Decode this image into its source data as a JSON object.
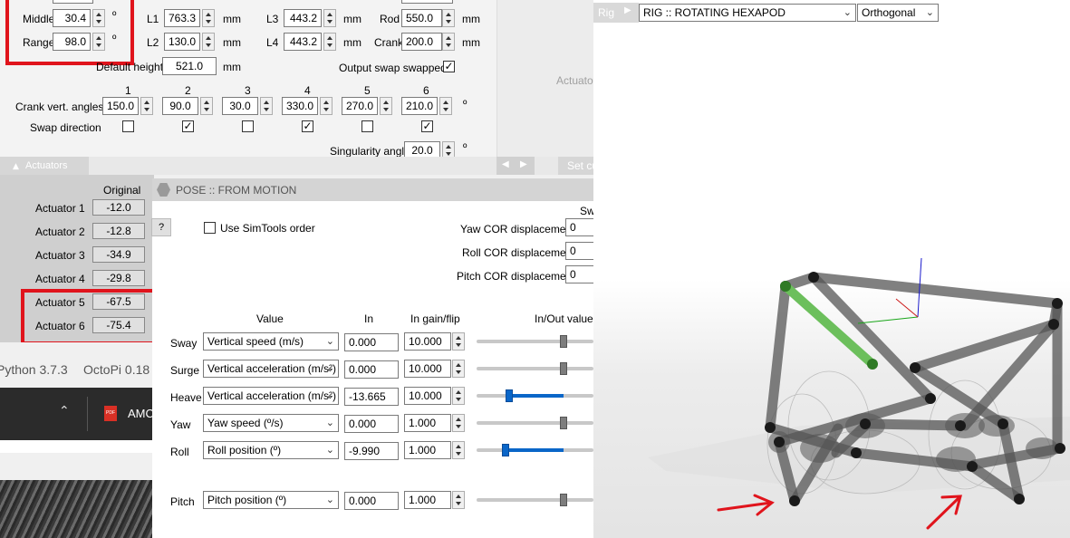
{
  "rig_panel": {
    "middle_label": "Middle",
    "middle_value": "30.4",
    "middle_unit": "º",
    "range_label": "Range",
    "range_value": "98.0",
    "range_unit": "º",
    "l1_label": "L1",
    "l1_value": "763.3",
    "l2_label": "L2",
    "l2_value": "130.0",
    "l3_label": "L3",
    "l3_value": "443.2",
    "l4_label": "L4",
    "l4_value": "443.2",
    "rod_label": "Rod",
    "rod_value": "550.0",
    "crank_label": "Crank",
    "crank_value": "200.0",
    "mm": "mm",
    "default_height_label": "Default height",
    "default_height_value": "521.0",
    "output_swap_label": "Output swap swapped",
    "output_swap_checked": "✓",
    "crank_angles_label": "Crank vert. angles",
    "columns": [
      "1",
      "2",
      "3",
      "4",
      "5",
      "6"
    ],
    "crank_angles": [
      "150.0",
      "90.0",
      "30.0",
      "330.0",
      "270.0",
      "210.0"
    ],
    "angle_unit": "º",
    "swap_direction_label": "Swap direction",
    "swap_checks": [
      "",
      "✓",
      "",
      "✓",
      "",
      "✓"
    ],
    "singularity_label": "Singularity angle",
    "singularity_value": "20.0",
    "singularity_unit": "º",
    "actuator_side_text": "Actuato",
    "nav_left": "◀",
    "nav_right": "▶",
    "set_label": "Set cu"
  },
  "actuators": {
    "header": "Actuators",
    "original_label": "Original",
    "rows": [
      {
        "label": "Actuator 1",
        "value": "-12.0"
      },
      {
        "label": "Actuator 2",
        "value": "-12.8"
      },
      {
        "label": "Actuator 3",
        "value": "-34.9"
      },
      {
        "label": "Actuator 4",
        "value": "-29.8"
      },
      {
        "label": "Actuator 5",
        "value": "-67.5"
      },
      {
        "label": "Actuator 6",
        "value": "-75.4"
      }
    ]
  },
  "background": {
    "python_text": "Python 3.7.3",
    "octopi_text": "OctoPi 0.18",
    "pdf_text": "AMC"
  },
  "pose": {
    "title": "POSE :: FROM MOTION",
    "help": "?",
    "simtools_label": "Use SimTools order",
    "sw_label": "Sw",
    "yaw_cor_label": "Yaw COR displacement",
    "yaw_cor_value": "0",
    "roll_cor_label": "Roll COR displacement",
    "roll_cor_value": "0",
    "pitch_cor_label": "Pitch COR displacement",
    "pitch_cor_value": "0",
    "col_value": "Value",
    "col_in": "In",
    "col_gain": "In gain/flip",
    "col_inout": "In/Out value",
    "rows": [
      {
        "axis": "Sway",
        "value": "Vertical speed (m/s)",
        "in": "0.000",
        "gain": "10.000",
        "level": 0.0
      },
      {
        "axis": "Surge",
        "value": "Vertical acceleration (m/s²)",
        "in": "0.000",
        "gain": "10.000",
        "level": 0.0
      },
      {
        "axis": "Heave",
        "value": "Vertical acceleration (m/s²)",
        "in": "-13.665",
        "gain": "10.000",
        "level": -0.75
      },
      {
        "axis": "Yaw",
        "value": "Yaw speed (º/s)",
        "in": "0.000",
        "gain": "1.000",
        "level": 0.0
      },
      {
        "axis": "Roll",
        "value": "Roll position (º)",
        "in": "-9.990",
        "gain": "1.000",
        "level": -0.8
      },
      {
        "axis": "Pitch",
        "value": "Pitch position (º)",
        "in": "0.000",
        "gain": "1.000",
        "level": 0.0
      }
    ]
  },
  "viewport": {
    "rig_label": "Rig",
    "rig_select": "RIG :: ROTATING HEXAPOD",
    "projection": "Orthogonal"
  },
  "colors": {
    "accent": "#0a66c8",
    "highlight": "#e0141c",
    "actuator_green": "#6cbf5c"
  }
}
